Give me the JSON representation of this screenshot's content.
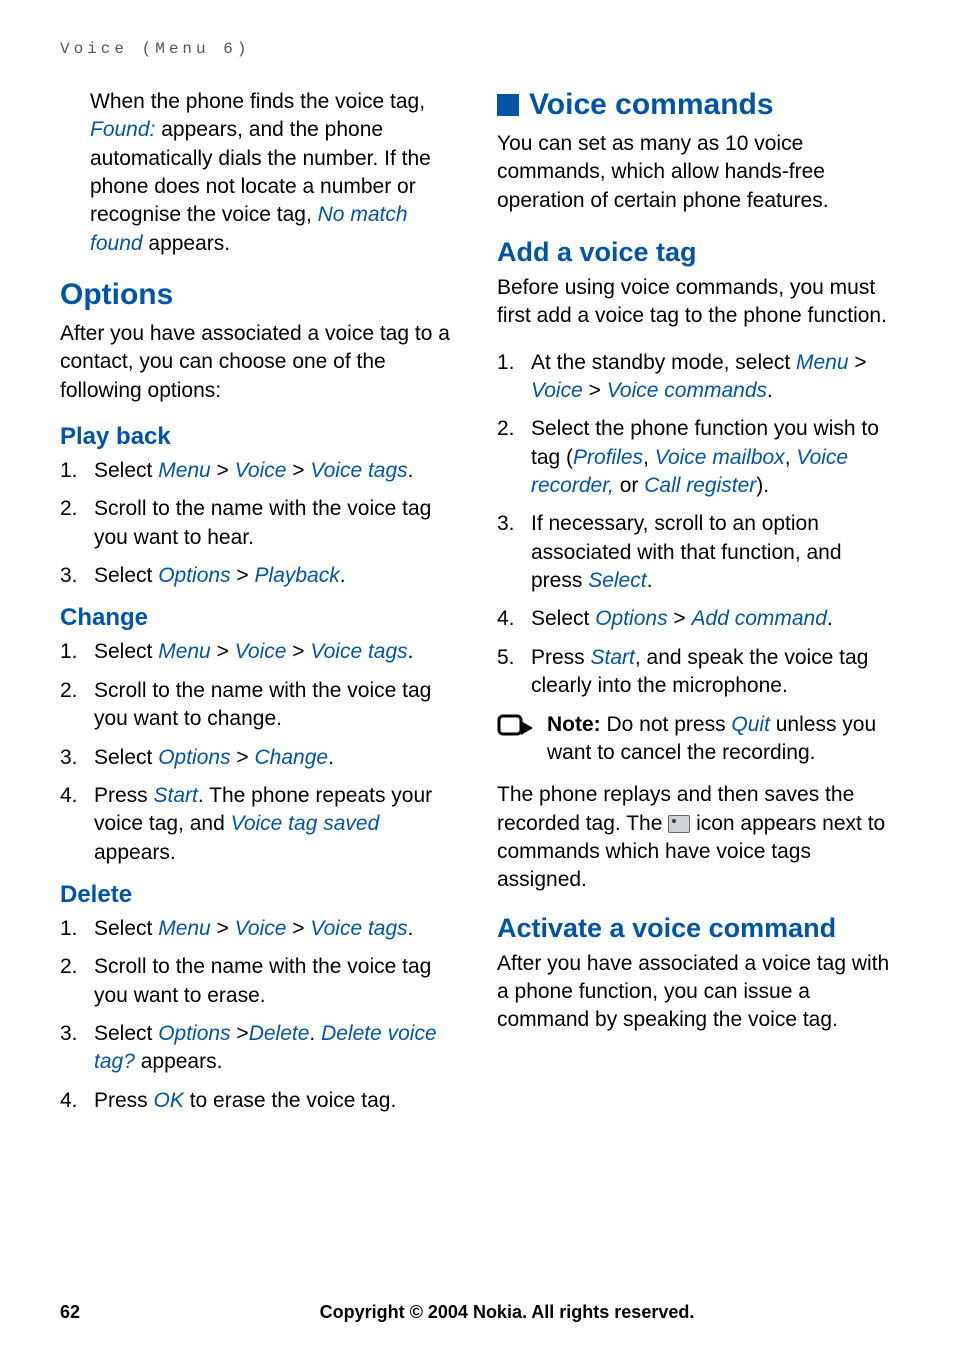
{
  "header": "Voice (Menu 6)",
  "left": {
    "intro": {
      "p1a": "When the phone finds the voice tag, ",
      "found": "Found:",
      "p1b": " appears, and the phone automatically dials the number. If the phone does not locate a number or recognise the voice tag, ",
      "nomatch": "No match found",
      "p1c": " appears."
    },
    "options_title": "Options",
    "options_para": "After you have associated a voice tag to a contact, you can choose one of the following options:",
    "playback": {
      "title": "Play back",
      "s1": {
        "n": "1.",
        "a": "Select ",
        "menu": "Menu",
        "gt1": " > ",
        "voice": "Voice",
        "gt2": " > ",
        "vtags": "Voice tags",
        "dot": "."
      },
      "s2": {
        "n": "2.",
        "txt": "Scroll to the name with the voice tag you want to hear."
      },
      "s3": {
        "n": "3.",
        "a": "Select ",
        "opt": "Options",
        "gt": " > ",
        "pb": "Playback",
        "dot": "."
      }
    },
    "change": {
      "title": "Change",
      "s1": {
        "n": "1.",
        "a": "Select ",
        "menu": "Menu",
        "gt1": " > ",
        "voice": "Voice",
        "gt2": " > ",
        "vtags": "Voice tags",
        "dot": "."
      },
      "s2": {
        "n": "2.",
        "txt": "Scroll to the name with the voice tag you want to change."
      },
      "s3": {
        "n": "3.",
        "a": "Select ",
        "opt": "Options",
        "gt": " > ",
        "chg": "Change",
        "dot": "."
      },
      "s4": {
        "n": "4.",
        "a": "Press ",
        "start": "Start",
        "b": ". The phone repeats your voice tag, and ",
        "saved": "Voice tag saved",
        "c": " appears."
      }
    },
    "del": {
      "title": "Delete",
      "s1": {
        "n": "1.",
        "a": "Select ",
        "menu": "Menu",
        "gt1": " > ",
        "voice": "Voice",
        "gt2": " > ",
        "vtags": "Voice tags",
        "dot": "."
      },
      "s2": {
        "n": "2.",
        "txt": "Scroll to the name with the voice tag you want to erase."
      },
      "s3": {
        "n": "3.",
        "a": "Select ",
        "opt": "Options",
        "gt": " >",
        "delete": "Delete",
        "b": ". ",
        "delq": "Delete voice tag?",
        "c": " appears."
      },
      "s4": {
        "n": "4.",
        "a": "Press ",
        "ok": "OK",
        "b": " to erase the voice tag."
      }
    }
  },
  "right": {
    "voice_commands_title": "Voice commands",
    "vc_para": "You can set as many as 10 voice commands, which allow hands-free operation of certain phone features.",
    "add_title": "Add a voice tag",
    "add_para": "Before using voice commands, you must first add a voice tag to the phone function.",
    "add": {
      "s1": {
        "n": "1.",
        "a": "At the standby mode, select ",
        "menu": "Menu",
        "gt1": " > ",
        "voice": "Voice",
        "gt2": " > ",
        "vc": "Voice commands",
        "dot": "."
      },
      "s2": {
        "n": "2.",
        "a": "Select the phone function you wish to tag (",
        "profiles": "Profiles",
        "c1": ", ",
        "vmail": "Voice mailbox",
        "c2": ", ",
        "vrec": "Voice recorder,",
        "or": " or ",
        "creg": "Call register",
        "end": ")."
      },
      "s3": {
        "n": "3.",
        "a": "If necessary, scroll to an option associated with that function, and press ",
        "select": "Select",
        "dot": "."
      },
      "s4": {
        "n": "4.",
        "a": "Select ",
        "opt": "Options",
        "gt": " > ",
        "addc": "Add command",
        "dot": "."
      },
      "s5": {
        "n": "5.",
        "a": "Press ",
        "start": "Start",
        "b": ", and speak the voice tag clearly into the microphone."
      }
    },
    "note_label": "Note:",
    "note_a": " Do not press ",
    "note_quit": "Quit",
    "note_b": " unless you want to cancel the recording.",
    "replay_a": "The phone replays and then saves the recorded tag. The ",
    "replay_b": " icon appears next to commands which have voice tags assigned.",
    "activate_title": "Activate a voice command",
    "activate_para": "After you have associated a voice tag with a phone function, you can issue a command by speaking the voice tag."
  },
  "footer": {
    "page": "62",
    "copyright": "Copyright © 2004 Nokia. All rights reserved."
  }
}
